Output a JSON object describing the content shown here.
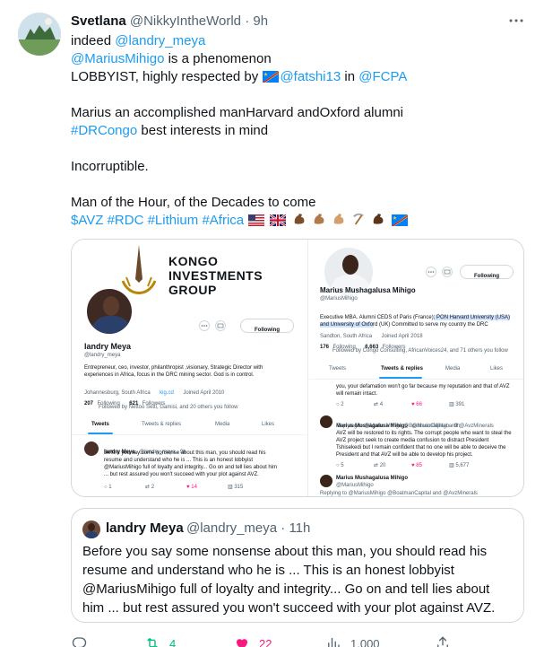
{
  "author": {
    "name": "Svetlana",
    "handle": "@NikkyIntheWorld",
    "separator": "·",
    "time": "9h"
  },
  "tweet": {
    "line1_text": "indeed ",
    "line1_mention": "@landry_meya",
    "line2_mention": "@MariusMihigo",
    "line2_text": " is a phenomenon",
    "line3_text": "LOBBYIST, highly respected by",
    "line3_mention1": "@fatshi13",
    "line3_in": " in ",
    "line3_mention2": "@FCPA",
    "line4_text": "Marius an accomplished manHarvard andOxford alumni",
    "line5_hashtag": "#DRCongo",
    "line5_text": " best interests in mind",
    "line6_text": "Incorruptible.",
    "line7_text": "Man of the Hour, of the Decades to come",
    "line8_tags": "$AVZ #RDC #Lithium #Africa"
  },
  "media": {
    "left": {
      "company_line1": "KONGO",
      "company_line2": "INVESTMENTS",
      "company_line3": "GROUP",
      "follow_label": "Following",
      "name": "landry Meya",
      "handle": "@landry_meya",
      "bio1": "Entrepreneur, ceo, investor, philanthropist ,visionary, Strategic Director with",
      "bio2": "experiences in Africa, focus in the DRC  mining sector. God is in control.",
      "location": "Johannesburg, South Africa",
      "link": "kig.cd",
      "joined": "Joined April 2010",
      "following_count": "207",
      "following_label": "Following",
      "followers_count": "621",
      "followers_label": "Followers",
      "followed_by": "Followed by Nettoo Setti, Gamisi, and 20 others you follow",
      "tabs": [
        "Tweets",
        "Tweets & replies",
        "Media",
        "Likes"
      ],
      "post_name": "landry Meya",
      "post_meta": "@landry_meya · 9h",
      "post1": "Before you say some nonsense about this man, you should read his",
      "post2": "resume and understand who he is ... This is an honest lobbyist",
      "post3": "@MariusMihigo full of loyalty and integrity... Go on and tell lies about him",
      "post4": "... but rest assured you won't succeed with your plot against AVZ.",
      "stats": [
        "1",
        "2",
        "14",
        "315"
      ]
    },
    "right": {
      "follow_label": "Following",
      "name": "Marius Mushagalusa Mihigo",
      "handle": "@MariusMihigo",
      "bio1": "Executive MBA. Alumni CEDS of Paris (France); PON Harvard University (USA)",
      "bio2": "and University of Oxford (UK) Committed to serve my country the DRC",
      "location": "Sandton, South Africa",
      "joined": "Joined April 2018",
      "following_count": "176",
      "following_label": "Following",
      "followers_count": "6,663",
      "followers_label": "Followers",
      "followed_by": "Followed by Congo Consulting, AfricanVoices24, and 71 others you follow",
      "tabs": [
        "Tweets",
        "Tweets & replies",
        "Media",
        "Likes"
      ],
      "reply_top1": "you, your defamation won't go far because my reputation and that of AVZ",
      "reply_top2": "will remain intact.",
      "top_stats": [
        "2",
        "4",
        "66",
        "391"
      ],
      "post_name": "Marius Mushagalusa Mihigo",
      "post_meta": "@MariusMihigo · 9h",
      "replying": "Replying to @MariusMihigo @BoatmanCapital and @AvzMinerals",
      "post1": "AVZ will be restored to its rights. The corrupt people who want to steal the",
      "post2": "AVZ project seek to create media confusion to distract President",
      "post3": "Tshisekedi but I remain confident that no one will be able to deceive the",
      "post4": "President and that AVZ will be able to develop his project.",
      "stats": [
        "5",
        "20",
        "85",
        "5,677"
      ],
      "post2_name": "Marius Mushagalusa Mihigo",
      "post2_handle": "@MariusMihigo",
      "bottom_replying": "Replying to @MariusMihigo @BoatmanCapital and @AvzMinerals"
    }
  },
  "quote": {
    "name": "landry Meya",
    "handle": "@landry_meya",
    "separator": "·",
    "time": "11h",
    "text": "Before you say some nonsense about this man, you should read his resume and understand who he is ... This is an honest lobbyist @MariusMihigo full of loyalty and integrity... Go on and tell lies about him ... but rest assured you won't succeed with your plot against AVZ."
  },
  "actions": {
    "reply_count": "",
    "retweet_count": "4",
    "like_count": "22",
    "views_count": "1,000",
    "share_label": ""
  },
  "colors": {
    "link": "#1d9bf0",
    "retweet": "#00ba7c",
    "like": "#f91880",
    "muted": "#536471",
    "border": "#cfd9de"
  },
  "icons": [
    "more-icon",
    "reply-icon",
    "retweet-icon",
    "like-icon",
    "views-icon",
    "share-icon"
  ]
}
